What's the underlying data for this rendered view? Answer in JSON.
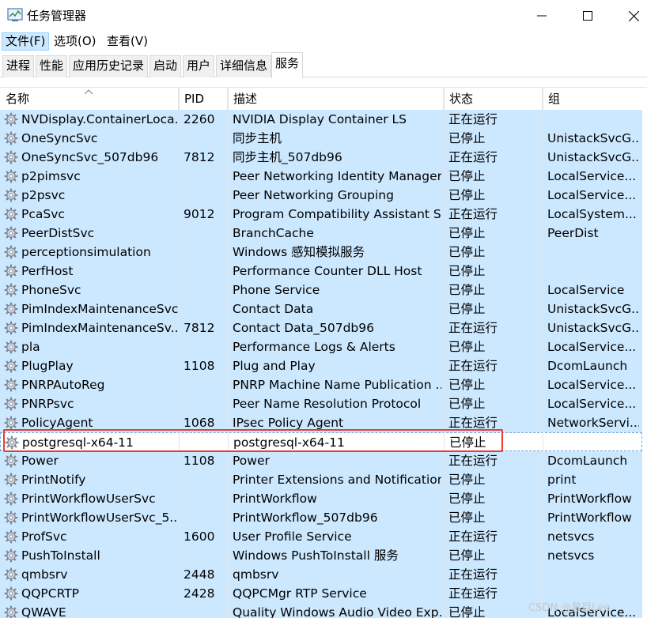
{
  "window": {
    "title": "任务管理器",
    "controls": [
      "minimize",
      "maximize",
      "close"
    ]
  },
  "menu": [
    {
      "label": "文件(F)",
      "active": true
    },
    {
      "label": "选项(O)",
      "active": false
    },
    {
      "label": "查看(V)",
      "active": false
    }
  ],
  "tabs": [
    {
      "label": "进程",
      "selected": false
    },
    {
      "label": "性能",
      "selected": false
    },
    {
      "label": "应用历史记录",
      "selected": false
    },
    {
      "label": "启动",
      "selected": false
    },
    {
      "label": "用户",
      "selected": false
    },
    {
      "label": "详细信息",
      "selected": false
    },
    {
      "label": "服务",
      "selected": true
    }
  ],
  "columns": {
    "name": "名称",
    "pid": "PID",
    "desc": "描述",
    "status": "状态",
    "group": "组"
  },
  "sort": {
    "column": "name",
    "direction": "ascending"
  },
  "services": [
    {
      "name": "NVDisplay.ContainerLoca...",
      "pid": "2260",
      "desc": "NVIDIA Display Container LS",
      "status": "正在运行",
      "group": ""
    },
    {
      "name": "OneSyncSvc",
      "pid": "",
      "desc": "同步主机",
      "status": "已停止",
      "group": "UnistackSvcG..."
    },
    {
      "name": "OneSyncSvc_507db96",
      "pid": "7812",
      "desc": "同步主机_507db96",
      "status": "正在运行",
      "group": "UnistackSvcG..."
    },
    {
      "name": "p2pimsvc",
      "pid": "",
      "desc": "Peer Networking Identity Manager",
      "status": "已停止",
      "group": "LocalService..."
    },
    {
      "name": "p2psvc",
      "pid": "",
      "desc": "Peer Networking Grouping",
      "status": "已停止",
      "group": "LocalService..."
    },
    {
      "name": "PcaSvc",
      "pid": "9012",
      "desc": "Program Compatibility Assistant S...",
      "status": "正在运行",
      "group": "LocalSystem..."
    },
    {
      "name": "PeerDistSvc",
      "pid": "",
      "desc": "BranchCache",
      "status": "已停止",
      "group": "PeerDist"
    },
    {
      "name": "perceptionsimulation",
      "pid": "",
      "desc": "Windows 感知模拟服务",
      "status": "已停止",
      "group": ""
    },
    {
      "name": "PerfHost",
      "pid": "",
      "desc": "Performance Counter DLL Host",
      "status": "已停止",
      "group": ""
    },
    {
      "name": "PhoneSvc",
      "pid": "",
      "desc": "Phone Service",
      "status": "已停止",
      "group": "LocalService"
    },
    {
      "name": "PimIndexMaintenanceSvc",
      "pid": "",
      "desc": "Contact Data",
      "status": "已停止",
      "group": "UnistackSvcG..."
    },
    {
      "name": "PimIndexMaintenanceSv...",
      "pid": "7812",
      "desc": "Contact Data_507db96",
      "status": "正在运行",
      "group": "UnistackSvcG..."
    },
    {
      "name": "pla",
      "pid": "",
      "desc": "Performance Logs & Alerts",
      "status": "已停止",
      "group": "LocalService..."
    },
    {
      "name": "PlugPlay",
      "pid": "1108",
      "desc": "Plug and Play",
      "status": "正在运行",
      "group": "DcomLaunch"
    },
    {
      "name": "PNRPAutoReg",
      "pid": "",
      "desc": "PNRP Machine Name Publication ...",
      "status": "已停止",
      "group": "LocalService..."
    },
    {
      "name": "PNRPsvc",
      "pid": "",
      "desc": "Peer Name Resolution Protocol",
      "status": "已停止",
      "group": "LocalService..."
    },
    {
      "name": "PolicyAgent",
      "pid": "1068",
      "desc": "IPsec Policy Agent",
      "status": "正在运行",
      "group": "NetworkServi..."
    },
    {
      "name": "postgresql-x64-11",
      "pid": "",
      "desc": "postgresql-x64-11",
      "status": "已停止",
      "group": "",
      "focused": true
    },
    {
      "name": "Power",
      "pid": "1108",
      "desc": "Power",
      "status": "正在运行",
      "group": "DcomLaunch"
    },
    {
      "name": "PrintNotify",
      "pid": "",
      "desc": "Printer Extensions and Notifications",
      "status": "已停止",
      "group": "print"
    },
    {
      "name": "PrintWorkflowUserSvc",
      "pid": "",
      "desc": "PrintWorkflow",
      "status": "已停止",
      "group": "PrintWorkflow"
    },
    {
      "name": "PrintWorkflowUserSvc_5...",
      "pid": "",
      "desc": "PrintWorkflow_507db96",
      "status": "已停止",
      "group": "PrintWorkflow"
    },
    {
      "name": "ProfSvc",
      "pid": "1600",
      "desc": "User Profile Service",
      "status": "正在运行",
      "group": "netsvcs"
    },
    {
      "name": "PushToInstall",
      "pid": "",
      "desc": "Windows PushToInstall 服务",
      "status": "已停止",
      "group": "netsvcs"
    },
    {
      "name": "qmbsrv",
      "pid": "2448",
      "desc": "qmbsrv",
      "status": "正在运行",
      "group": ""
    },
    {
      "name": "QQPCRTP",
      "pid": "2428",
      "desc": "QQPCMgr RTP Service",
      "status": "正在运行",
      "group": ""
    },
    {
      "name": "QWAVE",
      "pid": "",
      "desc": "Quality Windows Audio Video Exp...",
      "status": "已停止",
      "group": "LocalService..."
    }
  ],
  "colors": {
    "row_background": "#cce8ff",
    "annotation_box": "#e83a3a",
    "focus_border": "#6fa3d9"
  },
  "watermark": "CSDN @慕目Lee"
}
